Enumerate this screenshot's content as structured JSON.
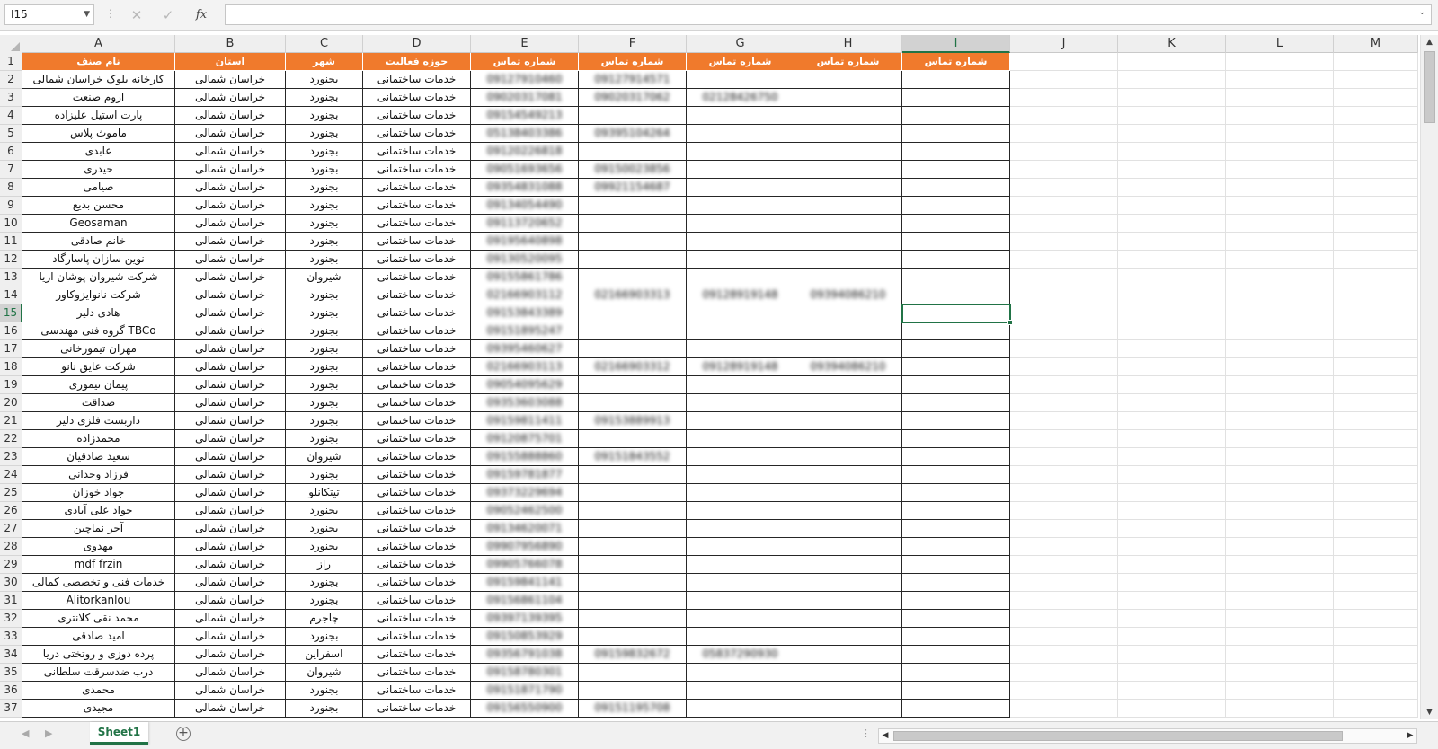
{
  "formula_bar": {
    "name_box": "I15",
    "fx_label": "fx",
    "formula_value": ""
  },
  "columns": [
    "A",
    "B",
    "C",
    "D",
    "E",
    "F",
    "G",
    "H",
    "I",
    "J",
    "K",
    "L",
    "M"
  ],
  "selected_cell": {
    "column": "I",
    "row": 15
  },
  "header_row": {
    "row_number": 1,
    "cells": [
      "نام صنف",
      "استان",
      "شهر",
      "حوزه فعالیت",
      "شماره تماس",
      "شماره تماس",
      "شماره تماس",
      "شماره تماس",
      "شماره تماس"
    ]
  },
  "rows": [
    {
      "n": 2,
      "name": "کارخانه بلوک خراسان شمالی",
      "province": "خراسان شمالی",
      "city": "بجنورد",
      "field": "خدمات ساختمانی",
      "e": "09127910460",
      "f": "09127914571",
      "g": "",
      "h": ""
    },
    {
      "n": 3,
      "name": "اروم صنعت",
      "province": "خراسان شمالی",
      "city": "بجنورد",
      "field": "خدمات ساختمانی",
      "e": "09020317081",
      "f": "09020317062",
      "g": "02128426750",
      "h": ""
    },
    {
      "n": 4,
      "name": "پارت استیل علیزاده",
      "province": "خراسان شمالی",
      "city": "بجنورد",
      "field": "خدمات ساختمانی",
      "e": "09154549213",
      "f": "",
      "g": "",
      "h": ""
    },
    {
      "n": 5,
      "name": "ماموث پلاس",
      "province": "خراسان شمالی",
      "city": "بجنورد",
      "field": "خدمات ساختمانی",
      "e": "05138403386",
      "f": "09395104264",
      "g": "",
      "h": ""
    },
    {
      "n": 6,
      "name": "عابدی",
      "province": "خراسان شمالی",
      "city": "بجنورد",
      "field": "خدمات ساختمانی",
      "e": "09120226818",
      "f": "",
      "g": "",
      "h": ""
    },
    {
      "n": 7,
      "name": "حیدری",
      "province": "خراسان شمالی",
      "city": "بجنورد",
      "field": "خدمات ساختمانی",
      "e": "09051693656",
      "f": "09150023856",
      "g": "",
      "h": ""
    },
    {
      "n": 8,
      "name": "صیامی",
      "province": "خراسان شمالی",
      "city": "بجنورد",
      "field": "خدمات ساختمانی",
      "e": "09354831088",
      "f": "09921154687",
      "g": "",
      "h": ""
    },
    {
      "n": 9,
      "name": "محسن بدیع",
      "province": "خراسان شمالی",
      "city": "بجنورد",
      "field": "خدمات ساختمانی",
      "e": "09134054490",
      "f": "",
      "g": "",
      "h": ""
    },
    {
      "n": 10,
      "name": "Geosaman",
      "province": "خراسان شمالی",
      "city": "بجنورد",
      "field": "خدمات ساختمانی",
      "e": "09113720652",
      "f": "",
      "g": "",
      "h": ""
    },
    {
      "n": 11,
      "name": "خانم صادقی",
      "province": "خراسان شمالی",
      "city": "بجنورد",
      "field": "خدمات ساختمانی",
      "e": "09195640898",
      "f": "",
      "g": "",
      "h": ""
    },
    {
      "n": 12,
      "name": "نوین سازان پاسارگاد",
      "province": "خراسان شمالی",
      "city": "بجنورد",
      "field": "خدمات ساختمانی",
      "e": "09130520095",
      "f": "",
      "g": "",
      "h": ""
    },
    {
      "n": 13,
      "name": "شرکت شیروان پوشان اریا",
      "province": "خراسان شمالی",
      "city": "شیروان",
      "field": "خدمات ساختمانی",
      "e": "09155861786",
      "f": "",
      "g": "",
      "h": ""
    },
    {
      "n": 14,
      "name": "شرکت نانوایزوکاور",
      "province": "خراسان شمالی",
      "city": "بجنورد",
      "field": "خدمات ساختمانی",
      "e": "02166903112",
      "f": "02166903313",
      "g": "09128919148",
      "h": "09394086210"
    },
    {
      "n": 15,
      "name": "هادی دلیر",
      "province": "خراسان شمالی",
      "city": "بجنورد",
      "field": "خدمات ساختمانی",
      "e": "09153843389",
      "f": "",
      "g": "",
      "h": ""
    },
    {
      "n": 16,
      "name": "گروه فنی مهندسی TBCo",
      "province": "خراسان شمالی",
      "city": "بجنورد",
      "field": "خدمات ساختمانی",
      "e": "09151895247",
      "f": "",
      "g": "",
      "h": ""
    },
    {
      "n": 17,
      "name": "مهران تیمورخانی",
      "province": "خراسان شمالی",
      "city": "بجنورد",
      "field": "خدمات ساختمانی",
      "e": "09395460627",
      "f": "",
      "g": "",
      "h": ""
    },
    {
      "n": 18,
      "name": "شرکت عایق نانو",
      "province": "خراسان شمالی",
      "city": "بجنورد",
      "field": "خدمات ساختمانی",
      "e": "02166903113",
      "f": "02166903312",
      "g": "09128919148",
      "h": "09394086210"
    },
    {
      "n": 19,
      "name": "پیمان تیموری",
      "province": "خراسان شمالی",
      "city": "بجنورد",
      "field": "خدمات ساختمانی",
      "e": "09054095629",
      "f": "",
      "g": "",
      "h": ""
    },
    {
      "n": 20,
      "name": "صداقت",
      "province": "خراسان شمالی",
      "city": "بجنورد",
      "field": "خدمات ساختمانی",
      "e": "09353603088",
      "f": "",
      "g": "",
      "h": ""
    },
    {
      "n": 21,
      "name": "داربست فلزی دلیر",
      "province": "خراسان شمالی",
      "city": "بجنورد",
      "field": "خدمات ساختمانی",
      "e": "09159811411",
      "f": "09153889913",
      "g": "",
      "h": ""
    },
    {
      "n": 22,
      "name": "محمدزاده",
      "province": "خراسان شمالی",
      "city": "بجنورد",
      "field": "خدمات ساختمانی",
      "e": "09120875701",
      "f": "",
      "g": "",
      "h": ""
    },
    {
      "n": 23,
      "name": "سعید صادقیان",
      "province": "خراسان شمالی",
      "city": "شیروان",
      "field": "خدمات ساختمانی",
      "e": "09155888860",
      "f": "09151843552",
      "g": "",
      "h": ""
    },
    {
      "n": 24,
      "name": "فرزاد وحدانی",
      "province": "خراسان شمالی",
      "city": "بجنورد",
      "field": "خدمات ساختمانی",
      "e": "09159781877",
      "f": "",
      "g": "",
      "h": ""
    },
    {
      "n": 25,
      "name": "جواد خوزان",
      "province": "خراسان شمالی",
      "city": "تیتکانلو",
      "field": "خدمات ساختمانی",
      "e": "09373229694",
      "f": "",
      "g": "",
      "h": ""
    },
    {
      "n": 26,
      "name": "جواد علی آبادی",
      "province": "خراسان شمالی",
      "city": "بجنورد",
      "field": "خدمات ساختمانی",
      "e": "09052462500",
      "f": "",
      "g": "",
      "h": ""
    },
    {
      "n": 27,
      "name": "آجر نماچین",
      "province": "خراسان شمالی",
      "city": "بجنورد",
      "field": "خدمات ساختمانی",
      "e": "09134620071",
      "f": "",
      "g": "",
      "h": ""
    },
    {
      "n": 28,
      "name": "مهدوی",
      "province": "خراسان شمالی",
      "city": "بجنورد",
      "field": "خدمات ساختمانی",
      "e": "09907956890",
      "f": "",
      "g": "",
      "h": ""
    },
    {
      "n": 29,
      "name": "mdf frzin",
      "province": "خراسان شمالی",
      "city": "راز",
      "field": "خدمات ساختمانی",
      "e": "09905766078",
      "f": "",
      "g": "",
      "h": ""
    },
    {
      "n": 30,
      "name": "خدمات فنی و تخصصی کمالی",
      "province": "خراسان شمالی",
      "city": "بجنورد",
      "field": "خدمات ساختمانی",
      "e": "09159841141",
      "f": "",
      "g": "",
      "h": ""
    },
    {
      "n": 31,
      "name": "Alitorkanlou",
      "province": "خراسان شمالی",
      "city": "بجنورد",
      "field": "خدمات ساختمانی",
      "e": "09156861104",
      "f": "",
      "g": "",
      "h": ""
    },
    {
      "n": 32,
      "name": "محمد نقی کلانتری",
      "province": "خراسان شمالی",
      "city": "چاجرم",
      "field": "خدمات ساختمانی",
      "e": "09397139395",
      "f": "",
      "g": "",
      "h": ""
    },
    {
      "n": 33,
      "name": "امید صادقی",
      "province": "خراسان شمالی",
      "city": "بجنورد",
      "field": "خدمات ساختمانی",
      "e": "09150853929",
      "f": "",
      "g": "",
      "h": ""
    },
    {
      "n": 34,
      "name": "پرده دوزی و روتختی دریا",
      "province": "خراسان شمالی",
      "city": "اسفراین",
      "field": "خدمات ساختمانی",
      "e": "09356791038",
      "f": "09159832672",
      "g": "05837290930",
      "h": ""
    },
    {
      "n": 35,
      "name": "درب ضدسرقت سلطانی",
      "province": "خراسان شمالی",
      "city": "شیروان",
      "field": "خدمات ساختمانی",
      "e": "09158780301",
      "f": "",
      "g": "",
      "h": ""
    },
    {
      "n": 36,
      "name": "محمدی",
      "province": "خراسان شمالی",
      "city": "بجنورد",
      "field": "خدمات ساختمانی",
      "e": "09151871790",
      "f": "",
      "g": "",
      "h": ""
    },
    {
      "n": 37,
      "name": "مجیدی",
      "province": "خراسان شمالی",
      "city": "بجنورد",
      "field": "خدمات ساختمانی",
      "e": "09156550900",
      "f": "09151195708",
      "g": "",
      "h": ""
    }
  ],
  "sheet_tabs": [
    "Sheet1"
  ],
  "colors": {
    "header_fill": "#f07a2c",
    "header_text": "#ffffff",
    "selection": "#217346"
  }
}
